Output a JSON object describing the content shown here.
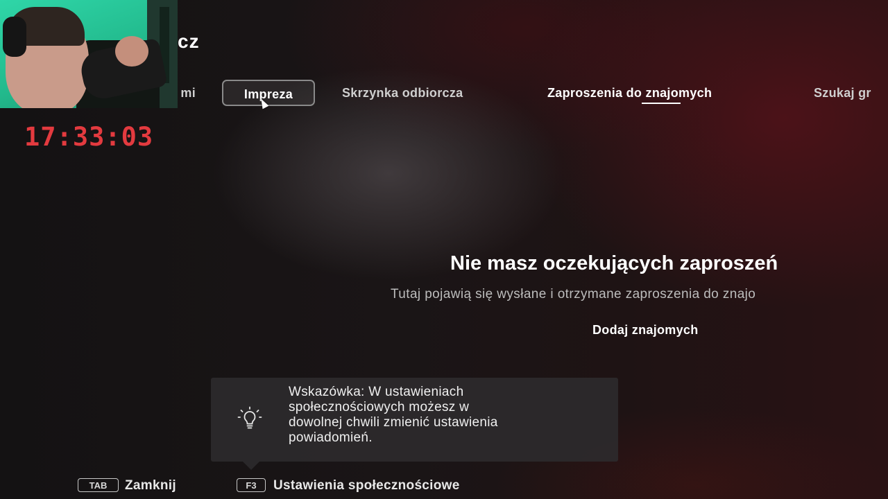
{
  "header": {
    "title_fragment": "cz"
  },
  "tabs": [
    {
      "label": "mi",
      "state": "partially-visible"
    },
    {
      "label": "Impreza",
      "state": "focused"
    },
    {
      "label": "Skrzynka odbiorcza",
      "state": "normal"
    },
    {
      "label": "Zaproszenia do znajomych",
      "state": "selected"
    },
    {
      "label": "Szukaj gr",
      "state": "cut-off"
    }
  ],
  "stream_overlay": {
    "timer": "17:33:03",
    "timer_color": "#e33a3f"
  },
  "empty_state": {
    "title": "Nie masz oczekujących zaproszeń",
    "description": "Tutaj pojawią się wysłane i otrzymane zaproszenia do znajo",
    "action_label": "Dodaj znajomych"
  },
  "tip": {
    "icon": "lightbulb-icon",
    "lines": [
      "Wskazówka: W ustawieniach",
      "społecznościowych możesz w",
      "dowolnej chwili zmienić ustawienia",
      "powiadomień."
    ]
  },
  "footer": {
    "close_key": "TAB",
    "close_label": "Zamknij",
    "settings_key": "F3",
    "settings_label": "Ustawienia społecznościowe"
  }
}
